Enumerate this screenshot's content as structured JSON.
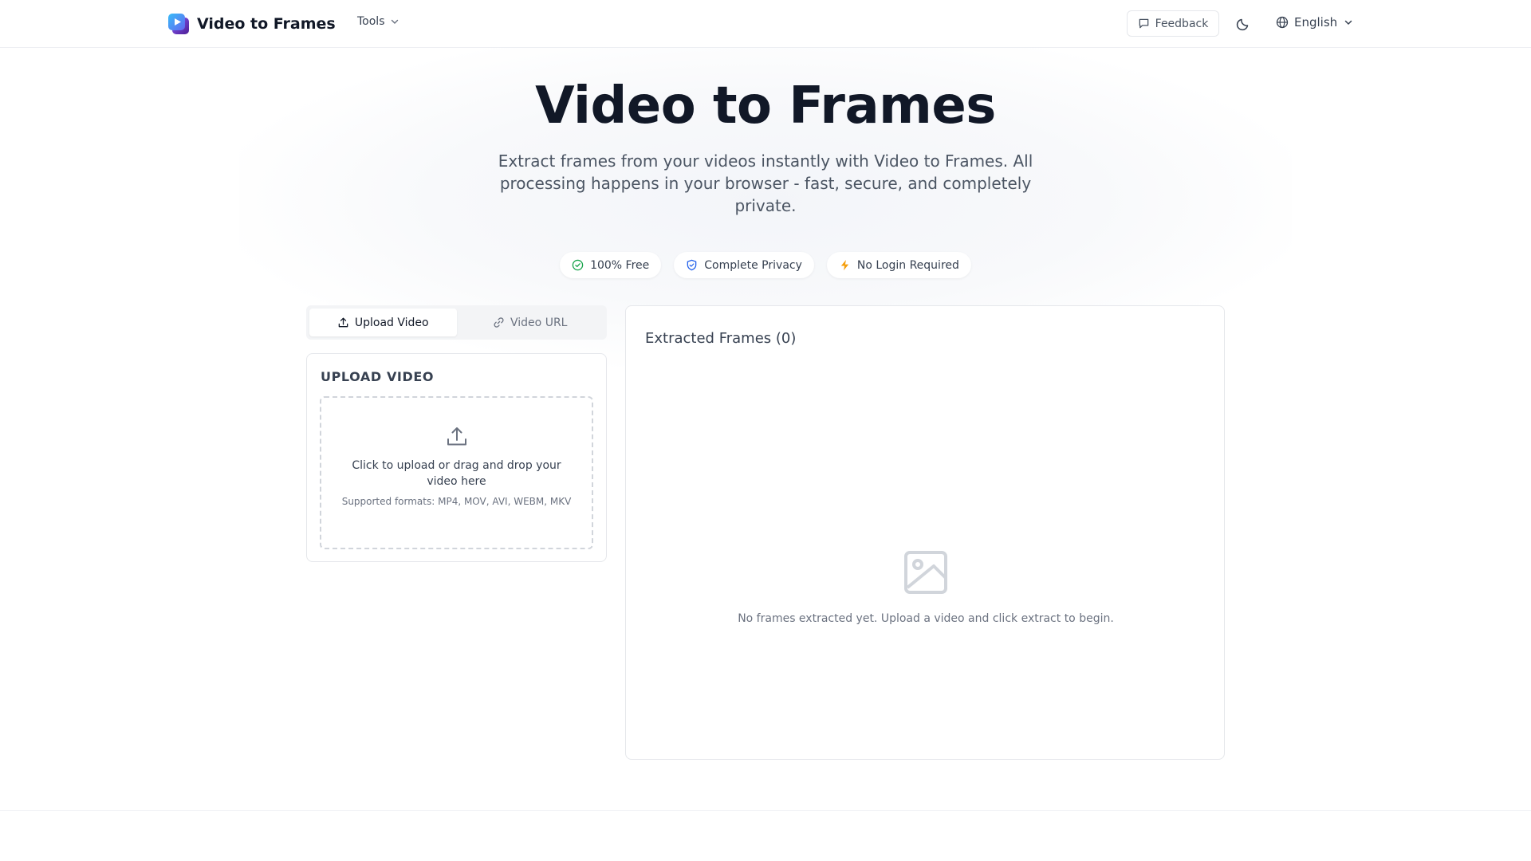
{
  "header": {
    "app_title": "Video to Frames",
    "tools_label": "Tools",
    "feedback_label": "Feedback",
    "language_label": "English"
  },
  "hero": {
    "title": "Video to Frames",
    "subtitle": "Extract frames from your videos instantly with Video to Frames. All processing happens in your browser - fast, secure, and completely private."
  },
  "badges": [
    {
      "label": "100% Free",
      "icon": "check-circle-icon",
      "color": "#16a34a"
    },
    {
      "label": "Complete Privacy",
      "icon": "shield-check-icon",
      "color": "#2563eb"
    },
    {
      "label": "No Login Required",
      "icon": "lightning-icon",
      "color": "#f59e0b"
    }
  ],
  "tabs": [
    {
      "label": "Upload Video",
      "icon": "upload-icon",
      "active": true
    },
    {
      "label": "Video URL",
      "icon": "link-icon",
      "active": false
    }
  ],
  "upload": {
    "heading": "UPLOAD VIDEO",
    "prompt": "Click to upload or drag and drop your video here",
    "formats": "Supported formats: MP4, MOV, AVI, WEBM, MKV"
  },
  "frames": {
    "title": "Extracted Frames (0)",
    "empty_text": "No frames extracted yet. Upload a video and click extract to begin."
  },
  "colors": {
    "accent": "#3b82f6",
    "logo_purple": "#7c3aed",
    "text_primary": "#111827",
    "text_muted": "#6b7280"
  }
}
